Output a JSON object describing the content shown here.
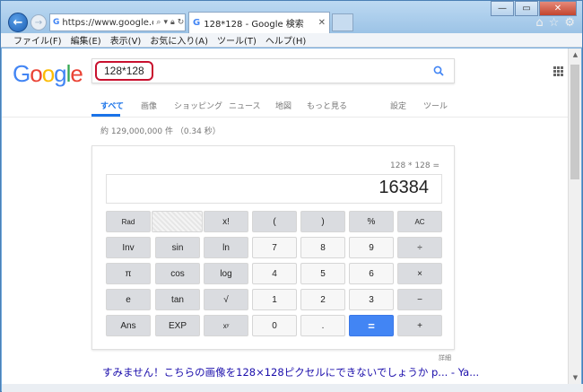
{
  "browser": {
    "url": "https://www.google.co.jp/",
    "tab_title": "128*128 - Google 検索",
    "menu": [
      "ファイル(F)",
      "編集(E)",
      "表示(V)",
      "お気に入り(A)",
      "ツール(T)",
      "ヘルプ(H)"
    ]
  },
  "google": {
    "logo": [
      "G",
      "o",
      "o",
      "g",
      "l",
      "e"
    ],
    "query": "128*128",
    "tabs": [
      "すべて",
      "画像",
      "ショッピング",
      "ニュース",
      "地図",
      "もっと見る",
      "設定",
      "ツール"
    ],
    "result_stats": "約 129,000,000 件 （0.34 秒）",
    "more_info": "詳細",
    "first_result": "すみません！こちらの画像を128×128ピクセルにできないでしょうか p... - Ya..."
  },
  "calculator": {
    "expression": "128 * 128 =",
    "result": "16384",
    "keys": {
      "rad": "Rad",
      "fact": "x!",
      "lparen": "(",
      "rparen": ")",
      "percent": "%",
      "ac": "AC",
      "inv": "Inv",
      "sin": "sin",
      "ln": "ln",
      "k7": "7",
      "k8": "8",
      "k9": "9",
      "div": "÷",
      "pi": "π",
      "cos": "cos",
      "log": "log",
      "k4": "4",
      "k5": "5",
      "k6": "6",
      "mul": "×",
      "e": "e",
      "tan": "tan",
      "sqrt": "√",
      "k1": "1",
      "k2": "2",
      "k3": "3",
      "sub": "−",
      "ans": "Ans",
      "exp": "EXP",
      "pow": "xʸ",
      "k0": "0",
      "dot": ".",
      "eq": "=",
      "add": "+"
    }
  },
  "colors": {
    "google_blue": "#4285f4",
    "google_red": "#ea4335",
    "google_yellow": "#fbbc05",
    "google_green": "#34a853",
    "link": "#1a0dab",
    "highlight_box": "#c8102e"
  }
}
